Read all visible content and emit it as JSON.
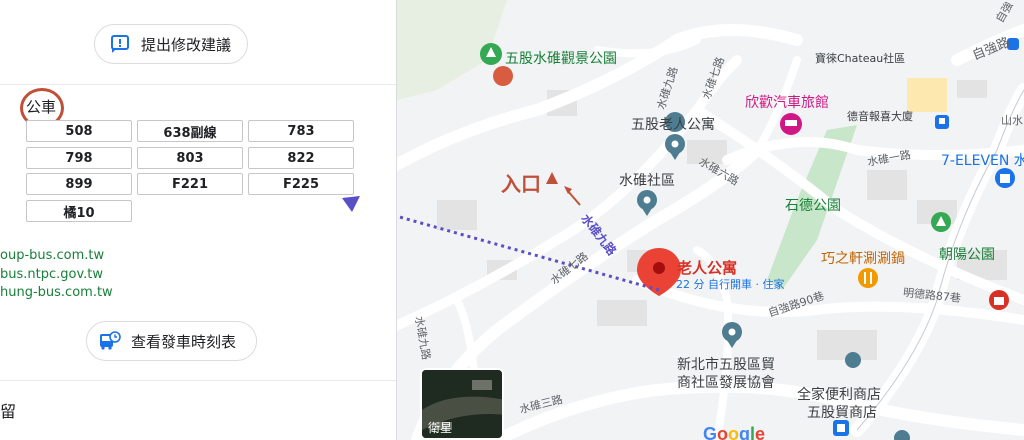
{
  "panel": {
    "suggest_label": "提出修改建議",
    "bus_label": "公車",
    "routes": [
      "508",
      "638副線",
      "783",
      "798",
      "803",
      "822",
      "899",
      "F221",
      "F225",
      "橘10"
    ],
    "links": [
      "oup-bus.com.tw",
      "bus.ntpc.gov.tw",
      "hung-bus.com.tw"
    ],
    "schedule_label": "查看發車時刻表",
    "bottom_text": "留"
  },
  "map": {
    "pois": {
      "park_scenic": "五股水碓觀景公園",
      "chateau": "寶徠Chateau社區",
      "motel": "欣歡汽車旅館",
      "elderly_apartment": "五股老人公寓",
      "shuidui_community": "水碓社區",
      "dexin_tower": "德音報喜大廈",
      "seven_eleven": "7-ELEVEN 水",
      "shide_park": "石德公園",
      "hotpot": "巧之軒涮涮鍋",
      "chaoyang_park": "朝陽公園",
      "selected_name": "老人公寓",
      "selected_sub": "22 分 自行開車 · 住家",
      "assoc_line1": "新北市五股區貿",
      "assoc_line2": "商社區發展協會",
      "familymart_line1": "全家便利商店",
      "familymart_line2": "五股貿商店"
    },
    "roads": {
      "ziqiang": "自強路",
      "ziqiang_90": "自強路90巷",
      "mingde_87": "明德路87巷",
      "shuidui_1": "水碓一路",
      "shuidui_6": "水碓六路",
      "shuidui_7a": "水碓七路",
      "shuidui_7b": "水碓七路",
      "shuidui_9a": "水碓九路",
      "shuidui_9b": "水碓九路",
      "shuidui_3": "水碓三路",
      "shan": "山水",
      "top_right": "自強",
      "entrance_road": "水碓九路"
    },
    "annotations": {
      "entrance": "入口"
    },
    "satellite_label": "衛星",
    "google_letters": [
      "G",
      "o",
      "o",
      "g",
      "l",
      "e"
    ],
    "colors": {
      "park_green": "#34a853",
      "motel_pink": "#d01884",
      "pin_red": "#ea4335",
      "poi_teal": "#4e7c91",
      "food_orange": "#f29900",
      "annotation_red": "#c0503a",
      "annotation_blue": "#5b4fc7",
      "link_blue": "#1a73e8"
    }
  }
}
